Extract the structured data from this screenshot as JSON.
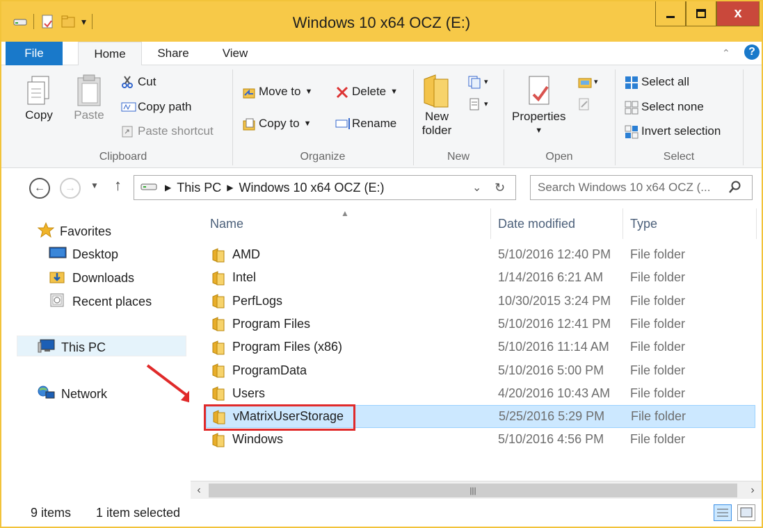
{
  "window": {
    "title": "Windows 10 x64 OCZ (E:)",
    "close_glyph": "x",
    "colors": {
      "titlebar": "#f7c948",
      "accent": "#1979ca",
      "highlight": "#e02a2a"
    }
  },
  "ribbon_tabs": {
    "file": "File",
    "home": "Home",
    "share": "Share",
    "view": "View"
  },
  "ribbon": {
    "clipboard": {
      "copy": "Copy",
      "paste": "Paste",
      "cut": "Cut",
      "copy_path": "Copy path",
      "paste_shortcut": "Paste shortcut",
      "label": "Clipboard"
    },
    "organize": {
      "move_to": "Move to",
      "copy_to": "Copy to",
      "delete": "Delete",
      "rename": "Rename",
      "label": "Organize"
    },
    "new": {
      "new_folder_line1": "New",
      "new_folder_line2": "folder",
      "label": "New"
    },
    "open": {
      "properties": "Properties",
      "label": "Open"
    },
    "select": {
      "select_all": "Select all",
      "select_none": "Select none",
      "invert_selection": "Invert selection",
      "label": "Select"
    }
  },
  "address": {
    "crumbs": [
      "This PC",
      "Windows 10 x64 OCZ (E:)"
    ],
    "search_placeholder": "Search Windows 10 x64 OCZ (..."
  },
  "nav_pane": {
    "favorites": "Favorites",
    "desktop": "Desktop",
    "downloads": "Downloads",
    "recent": "Recent places",
    "this_pc": "This PC",
    "network": "Network"
  },
  "columns": {
    "name": "Name",
    "date": "Date modified",
    "type": "Type"
  },
  "files": [
    {
      "name": "AMD",
      "date": "5/10/2016 12:40 PM",
      "type": "File folder"
    },
    {
      "name": "Intel",
      "date": "1/14/2016 6:21 AM",
      "type": "File folder"
    },
    {
      "name": "PerfLogs",
      "date": "10/30/2015 3:24 PM",
      "type": "File folder"
    },
    {
      "name": "Program Files",
      "date": "5/10/2016 12:41 PM",
      "type": "File folder"
    },
    {
      "name": "Program Files (x86)",
      "date": "5/10/2016 11:14 AM",
      "type": "File folder"
    },
    {
      "name": "ProgramData",
      "date": "5/10/2016 5:00 PM",
      "type": "File folder"
    },
    {
      "name": "Users",
      "date": "4/20/2016 10:43 AM",
      "type": "File folder"
    },
    {
      "name": "vMatrixUserStorage",
      "date": "5/25/2016 5:29 PM",
      "type": "File folder"
    },
    {
      "name": "Windows",
      "date": "5/10/2016 4:56 PM",
      "type": "File folder"
    }
  ],
  "status": {
    "count": "9 items",
    "selected": "1 item selected"
  }
}
